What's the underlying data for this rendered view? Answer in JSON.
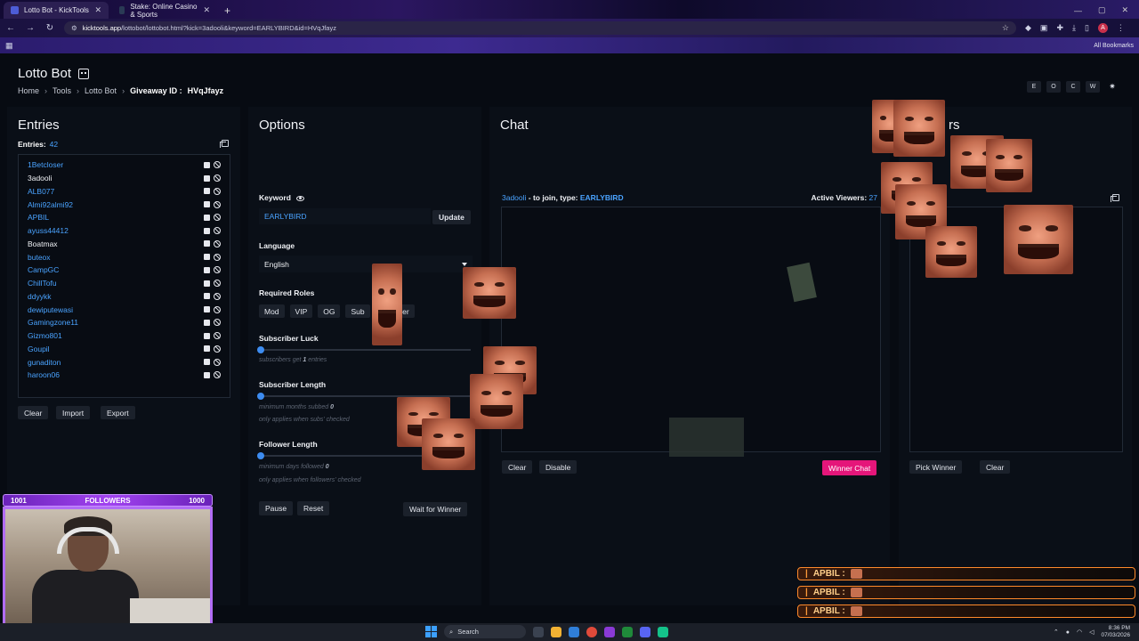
{
  "browser": {
    "tabs": [
      {
        "title": "Lotto Bot - KickTools",
        "active": true
      },
      {
        "title": "Stake: Online Casino & Sports",
        "active": false
      }
    ],
    "url_host": "kicktools.app",
    "url_path": "/lottobot/lottobot.html?kick=3adooli&keyword=EARLYBIRD&id=HVqJfayz",
    "all_bookmarks": "All Bookmarks"
  },
  "header": {
    "title": "Lotto Bot",
    "breadcrumb": [
      "Home",
      "Tools",
      "Lotto Bot"
    ],
    "giveaway_label": "Giveaway ID :",
    "giveaway_id": "HVqJfayz",
    "quick_buttons": [
      "E",
      "O",
      "C",
      "W"
    ]
  },
  "entries": {
    "title": "Entries",
    "count_label": "Entries:",
    "count": "42",
    "items": [
      {
        "name": "1Betcloser",
        "color": "blue"
      },
      {
        "name": "3adooli",
        "color": "white"
      },
      {
        "name": "ALB077",
        "color": "blue"
      },
      {
        "name": "Almi92almi92",
        "color": "blue"
      },
      {
        "name": "APBIL",
        "color": "blue"
      },
      {
        "name": "ayuss44412",
        "color": "blue"
      },
      {
        "name": "Boatmax",
        "color": "white"
      },
      {
        "name": "buteox",
        "color": "blue"
      },
      {
        "name": "CampGC",
        "color": "blue"
      },
      {
        "name": "ChillTofu",
        "color": "blue"
      },
      {
        "name": "ddyykk",
        "color": "blue"
      },
      {
        "name": "dewiputewasi",
        "color": "blue"
      },
      {
        "name": "Gamingzone11",
        "color": "blue"
      },
      {
        "name": "Gizmo801",
        "color": "blue"
      },
      {
        "name": "Goupil",
        "color": "blue"
      },
      {
        "name": "gunaditon",
        "color": "blue"
      },
      {
        "name": "haroon06",
        "color": "blue"
      }
    ],
    "buttons": {
      "clear": "Clear",
      "import": "Import",
      "export": "Export"
    }
  },
  "options": {
    "title": "Options",
    "keyword_label": "Keyword",
    "keyword_value": "EARLYBIRD",
    "update": "Update",
    "language_label": "Language",
    "language_value": "English",
    "roles_label": "Required Roles",
    "roles": [
      "Mod",
      "VIP",
      "OG",
      "Sub",
      "Follower"
    ],
    "sub_luck_label": "Subscriber Luck",
    "sub_luck_hint_pre": "subscribers get",
    "sub_luck_hint_val": "1",
    "sub_luck_hint_post": "entries",
    "sub_luck_value": 0,
    "sub_length_label": "Subscriber Length",
    "sub_length_hint_pre": "minimum months subbed",
    "sub_length_hint_val": "0",
    "sub_length_hint2": "only applies when subs' checked",
    "sub_length_value": 0,
    "follow_length_label": "Follower Length",
    "follow_length_hint_pre": "minimum days followed",
    "follow_length_hint_val": "0",
    "follow_length_hint2": "only applies when followers' checked",
    "follow_length_value": 0,
    "pause": "Pause",
    "reset": "Reset",
    "wait_for_winner": "Wait for Winner"
  },
  "chat": {
    "title": "Chat",
    "join_user": "3adooli",
    "join_text": " - to join, type: ",
    "join_keyword": "EARLYBIRD",
    "active_label": "Active Viewers:",
    "active_count": "27",
    "clear": "Clear",
    "disable": "Disable",
    "winner_chat": "Winner Chat",
    "accent": "#e5167a"
  },
  "winners": {
    "title_visible": "rs",
    "pick": "Pick Winner",
    "clear": "Clear"
  },
  "follower_widget": {
    "left": "1001",
    "label": "FOLLOWERS",
    "right": "1000"
  },
  "notifications": [
    "APBIL :",
    "APBIL :",
    "APBIL :"
  ],
  "taskbar": {
    "search": "Search",
    "time": "8:36 PM",
    "date": "07/03/2026"
  }
}
